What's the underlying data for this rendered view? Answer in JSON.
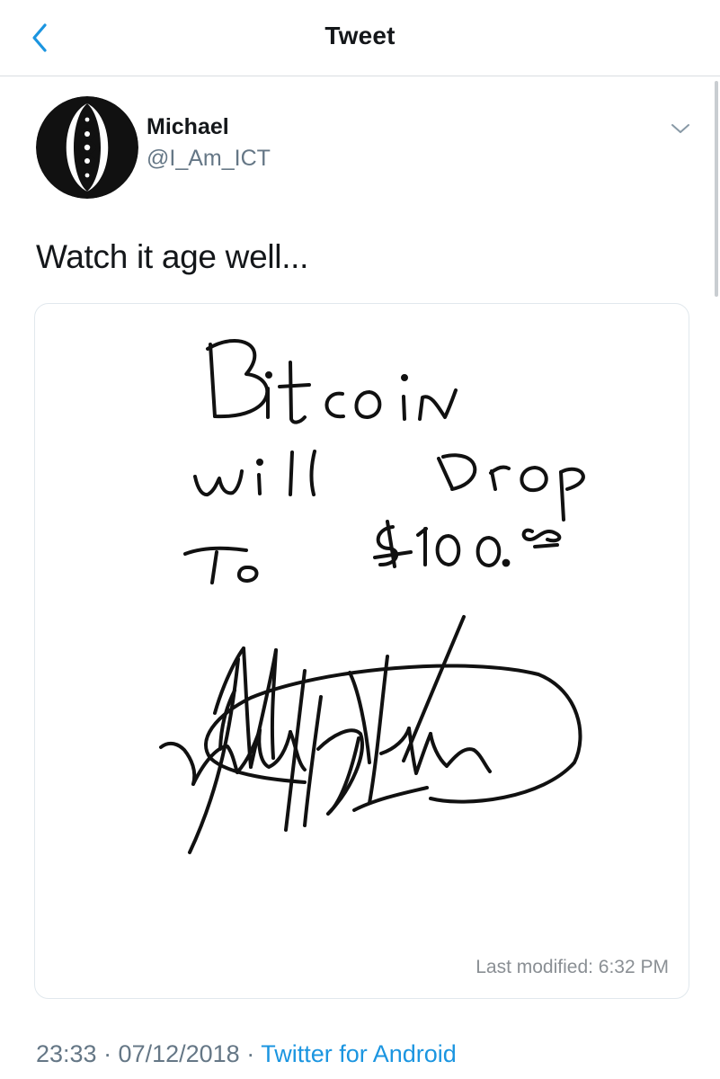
{
  "nav": {
    "title": "Tweet",
    "back_icon": "chevron-left-icon"
  },
  "author": {
    "name": "Michael",
    "handle": "@I_Am_ICT",
    "menu_icon": "chevron-down-icon"
  },
  "tweet": {
    "text": "Watch it age well...",
    "media": {
      "handwritten_lines": [
        "Bitcoin",
        "will Drop",
        "To $100.00"
      ],
      "signature": "Michael Huddleston",
      "last_modified": "Last modified: 6:32 PM"
    },
    "timestamp": "23:33 · 07/12/2018 · ",
    "source": "Twitter for Android"
  },
  "colors": {
    "accent": "#1b95e0",
    "secondary_text": "#657786",
    "primary_text": "#14171a"
  }
}
